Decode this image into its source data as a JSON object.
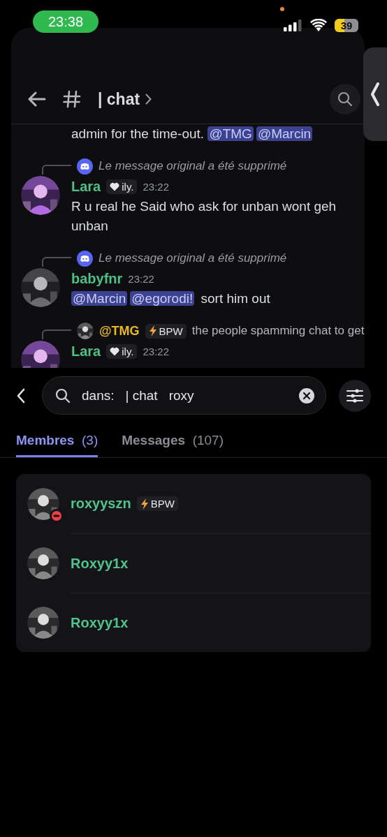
{
  "status_bar": {
    "time": "23:38",
    "battery": "39"
  },
  "header": {
    "channel": "| chat"
  },
  "messages": [
    {
      "parts": [
        {
          "kind": "text",
          "text": "admin for the time-out. "
        },
        {
          "kind": "mention",
          "text": "@TMG"
        },
        {
          "kind": "mention",
          "text": "@Marcin"
        }
      ]
    },
    {
      "reply": {
        "kind": "deleted",
        "text": "Le message original a été supprimé"
      },
      "author": "Lara",
      "color": "#4fbf86",
      "tag": "ily.",
      "time": "23:22",
      "parts": [
        {
          "kind": "text",
          "text": "R u real he Said who ask for unban wont geh unban"
        }
      ]
    },
    {
      "reply": {
        "kind": "deleted",
        "text": "Le message original a été supprimé"
      },
      "author": "babyfnr",
      "color": "#4fbf86",
      "time": "23:22",
      "parts": [
        {
          "kind": "mention",
          "text": "@Marcin"
        },
        {
          "kind": "mention",
          "text": "@egorodi!"
        },
        {
          "kind": "text",
          "text": " sort him out"
        }
      ]
    },
    {
      "reply": {
        "kind": "user",
        "author": "@TMG",
        "color": "#e8b923",
        "tag": "BPW",
        "text": "the people spamming chat to get"
      },
      "author": "Lara",
      "color": "#4fbf86",
      "tag": "ily.",
      "time": "23:22"
    }
  ],
  "search": {
    "filter_label": "dans:",
    "filter_value": "| chat",
    "query": "roxy"
  },
  "tabs": [
    {
      "label": "Membres",
      "count": "(3)",
      "selected": true
    },
    {
      "label": "Messages",
      "count": "(107)",
      "selected": false
    }
  ],
  "members": [
    {
      "name": "roxyyszn",
      "tag": "BPW",
      "do_not_disturb": true
    },
    {
      "name": "Roxyy1x",
      "do_not_disturb": false
    },
    {
      "name": "Roxyy1x",
      "do_not_disturb": false
    }
  ]
}
